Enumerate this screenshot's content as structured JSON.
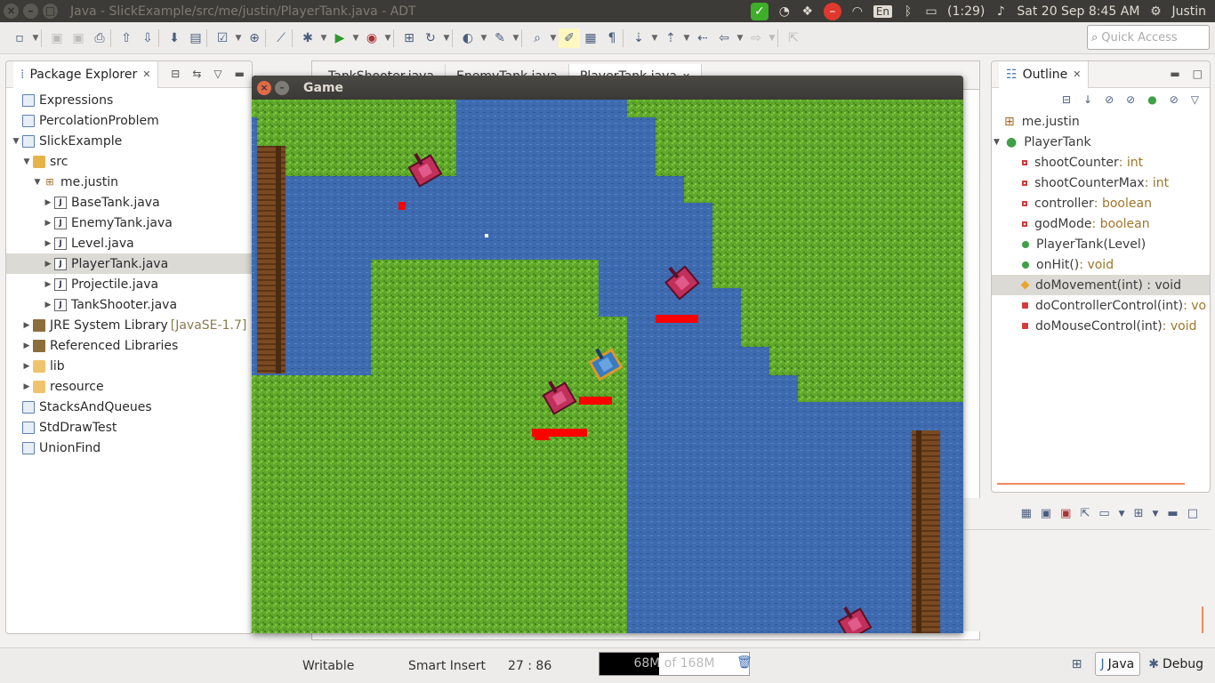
{
  "system_bar": {
    "window_title": "Java - SlickExample/src/me/justin/PlayerTank.java - ADT",
    "keyboard": "En",
    "battery": "(1:29)",
    "datetime": "Sat 20 Sep  8:45 AM",
    "user": "Justin"
  },
  "toolbar": {
    "quick_access_placeholder": "Quick Access"
  },
  "package_explorer": {
    "title": "Package Explorer",
    "items": [
      {
        "label": "Expressions",
        "level": 0,
        "arrow": "",
        "icon": "project-icon"
      },
      {
        "label": "PercolationProblem",
        "level": 0,
        "arrow": "",
        "icon": "project-icon"
      },
      {
        "label": "SlickExample",
        "level": 0,
        "arrow": "▼",
        "icon": "project-icon"
      },
      {
        "label": "src",
        "level": 1,
        "arrow": "▼",
        "icon": "source-folder-icon"
      },
      {
        "label": "me.justin",
        "level": 2,
        "arrow": "▼",
        "icon": "package-icon"
      },
      {
        "label": "BaseTank.java",
        "level": 3,
        "arrow": "▶",
        "icon": "java-file-icon"
      },
      {
        "label": "EnemyTank.java",
        "level": 3,
        "arrow": "▶",
        "icon": "java-file-icon"
      },
      {
        "label": "Level.java",
        "level": 3,
        "arrow": "▶",
        "icon": "java-file-icon"
      },
      {
        "label": "PlayerTank.java",
        "level": 3,
        "arrow": "▶",
        "icon": "java-file-icon",
        "selected": true
      },
      {
        "label": "Projectile.java",
        "level": 3,
        "arrow": "▶",
        "icon": "java-file-icon"
      },
      {
        "label": "TankShooter.java",
        "level": 3,
        "arrow": "▶",
        "icon": "java-file-icon"
      },
      {
        "label": "JRE System Library",
        "suffix": "[JavaSE-1.7]",
        "level": 1,
        "arrow": "▶",
        "icon": "library-icon"
      },
      {
        "label": "Referenced Libraries",
        "level": 1,
        "arrow": "▶",
        "icon": "library-icon"
      },
      {
        "label": "lib",
        "level": 1,
        "arrow": "▶",
        "icon": "folder-icon"
      },
      {
        "label": "resource",
        "level": 1,
        "arrow": "▶",
        "icon": "folder-icon"
      },
      {
        "label": "StacksAndQueues",
        "level": 0,
        "arrow": "",
        "icon": "project-icon"
      },
      {
        "label": "StdDrawTest",
        "level": 0,
        "arrow": "",
        "icon": "project-icon"
      },
      {
        "label": "UnionFind",
        "level": 0,
        "arrow": "",
        "icon": "project-icon"
      }
    ]
  },
  "editor": {
    "tabs": [
      "TankShooter.java",
      "EnemyTank.java",
      "PlayerTank.java"
    ],
    "active_tab": "PlayerTank.java"
  },
  "game_window": {
    "title": "Game"
  },
  "outline": {
    "title": "Outline",
    "items": [
      {
        "name": "me.justin",
        "type": "",
        "icon": "package-icon",
        "level": 0
      },
      {
        "name": "PlayerTank",
        "type": "",
        "icon": "class-icon",
        "level": 0
      },
      {
        "name": "shootCounter",
        "type": " : int",
        "icon": "private-field-icon",
        "level": 1
      },
      {
        "name": "shootCounterMax",
        "type": " : int",
        "icon": "private-field-icon",
        "level": 1
      },
      {
        "name": "controller",
        "type": " : boolean",
        "icon": "private-field-icon",
        "level": 1
      },
      {
        "name": "godMode",
        "type": " : boolean",
        "icon": "private-field-icon",
        "level": 1
      },
      {
        "name": "PlayerTank(Level)",
        "type": "",
        "icon": "constructor-icon",
        "level": 1
      },
      {
        "name": "onHit()",
        "type": " : void",
        "icon": "public-method-icon",
        "level": 1
      },
      {
        "name": "doMovement(int) : void",
        "type": "",
        "icon": "protected-method-icon",
        "level": 1,
        "selected": true
      },
      {
        "name": "doControllerControl(int)",
        "type": " : vo",
        "icon": "private-method-icon",
        "level": 1
      },
      {
        "name": "doMouseControl(int)",
        "type": " : void",
        "icon": "private-method-icon",
        "level": 1
      }
    ]
  },
  "status_bar": {
    "writable": "Writable",
    "insert_mode": "Smart Insert",
    "position": "27 : 86",
    "memory": "68M of 168M",
    "memory_fraction": 0.4,
    "perspective_java": "Java",
    "perspective_debug": "Debug"
  },
  "colors": {
    "grass": "#5a9e28",
    "water": "#3e6ab0",
    "wood": "#7a4a22",
    "enemy_tank": "#c0305a",
    "player_tank": "#3a7ac0",
    "health_bar": "#ff0000"
  }
}
